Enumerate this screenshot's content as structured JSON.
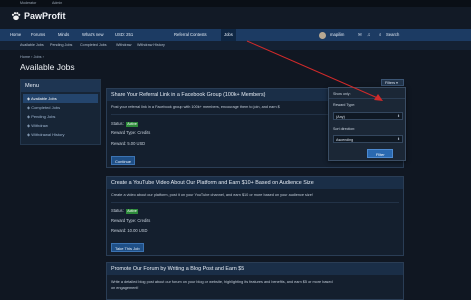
{
  "staff_bar": {
    "moderator": "Moderator",
    "admin": "Admin"
  },
  "brand": {
    "name": "PawProfit"
  },
  "nav": {
    "items": [
      "Home",
      "Forums",
      "Minds",
      "What's new",
      "USD: 251",
      "Referral Contests",
      "Jobs"
    ],
    "active": "Jobs",
    "user": "mapilim",
    "search": "Search"
  },
  "subnav": [
    "Available Jobs",
    "Pending Jobs",
    "Completed Jobs",
    "Withdraw",
    "Withdraw History"
  ],
  "breadcrumb": "Home  ›  Jobs  ›",
  "page_title": "Available Jobs",
  "menu": {
    "title": "Menu",
    "items": [
      "Available Jobs",
      "Completed Jobs",
      "Pending Jobs",
      "Withdraw",
      "Withdrawal History"
    ]
  },
  "filters_button": "Filters ▾",
  "filter_menu": {
    "show_only": "Show only:",
    "reward_type_label": "Reward Type:",
    "reward_type_value": "(Any)",
    "sort_label": "Sort direction:",
    "sort_value": "Ascending",
    "apply": "Filter"
  },
  "jobs": [
    {
      "title": "Share Your Referral Link in a Facebook Group (100k+ Members)",
      "description": "Post your referral link in a Facebook group with 100k+ members, encourage them to join, and earn $",
      "status_label": "Status:",
      "status": "Active",
      "reward_type": "Reward Type: Credits",
      "reward": "Reward: 5.00 USD",
      "button": "Continue"
    },
    {
      "title": "Create a YouTube Video About Our Platform and Earn $10+ Based on Audience Size",
      "description": "Create a video about our platform, post it on your YouTube channel, and earn $10 or more based on your audience size!",
      "status_label": "Status:",
      "status": "Active",
      "reward_type": "Reward Type: Credits",
      "reward": "Reward: 10.00 USD",
      "button": "Take This Job"
    },
    {
      "title": "Promote Our Forum by Writing a Blog Post and Earn $5",
      "description": "Write a detailed blog post about our forum on your blog or website, highlighting its features and benefits, and earn $5 or more based",
      "description2": "on engagement!"
    }
  ],
  "colors": {
    "nav": "#1c3b63",
    "accent": "#2a69b0",
    "active_badge": "#2d8a3a",
    "annotation_arrow": "#d12a2a"
  }
}
